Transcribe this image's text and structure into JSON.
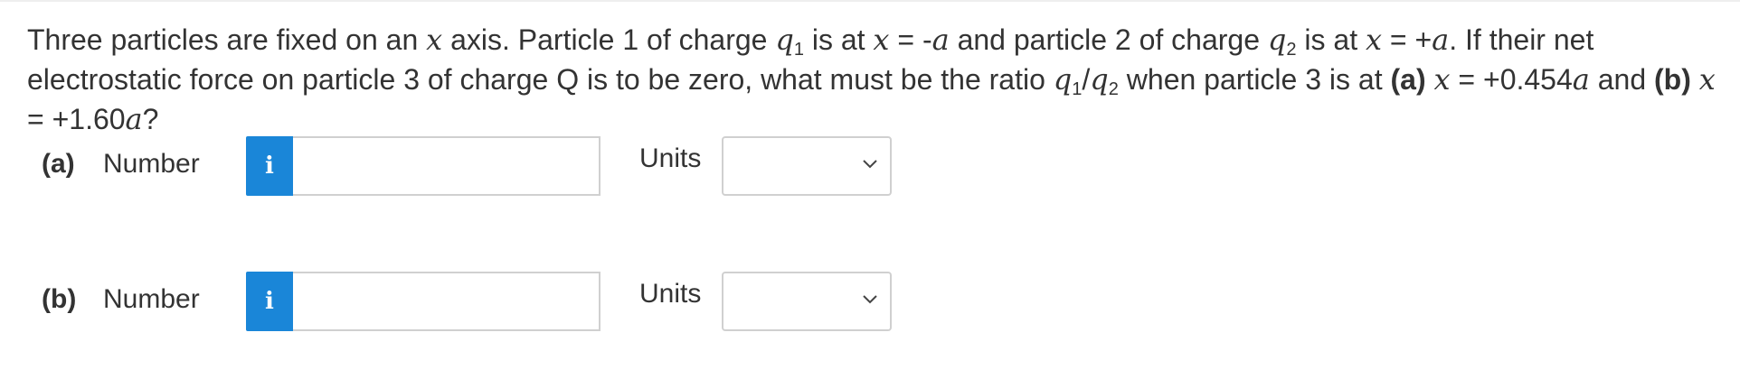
{
  "question": {
    "seg1": "Three particles are fixed on an ",
    "x1": "x",
    "seg2": " axis. Particle 1 of charge ",
    "q1": "q",
    "q1_sub": "1",
    "seg3": " is at ",
    "x2": "x",
    "seg4": " = -",
    "a1": "a",
    "seg5": " and particle 2 of charge ",
    "q2": "q",
    "q2_sub": "2",
    "seg6": " is at ",
    "x3": "x",
    "seg7": " = +",
    "a2": "a",
    "seg8": ". If their net electrostatic force on particle 3 of charge Q is to be zero, what must be the ratio ",
    "r_q1": "q",
    "r_q1_sub": "1",
    "slash": "/",
    "r_q2": "q",
    "r_q2_sub": "2",
    "seg9": " when particle 3 is at ",
    "part_a": "(a)",
    "seg10": " ",
    "x4": "x",
    "seg11": " = +0.454",
    "a3": "a",
    "seg12": " and ",
    "part_b": "(b)",
    "seg13": " ",
    "x5": "x",
    "seg14": " = +1.60",
    "a4": "a",
    "seg15": "?"
  },
  "answers": [
    {
      "part_label": "(a)",
      "number_label": "Number",
      "info_icon": "i",
      "value": "",
      "units_label": "Units",
      "units_value": ""
    },
    {
      "part_label": "(b)",
      "number_label": "Number",
      "info_icon": "i",
      "value": "",
      "units_label": "Units",
      "units_value": ""
    }
  ],
  "colors": {
    "info_button": "#1a86d8",
    "text": "#333333",
    "border": "#d0d0d0"
  },
  "icons": {
    "info": "info-icon",
    "dropdown": "chevron-down-icon"
  }
}
